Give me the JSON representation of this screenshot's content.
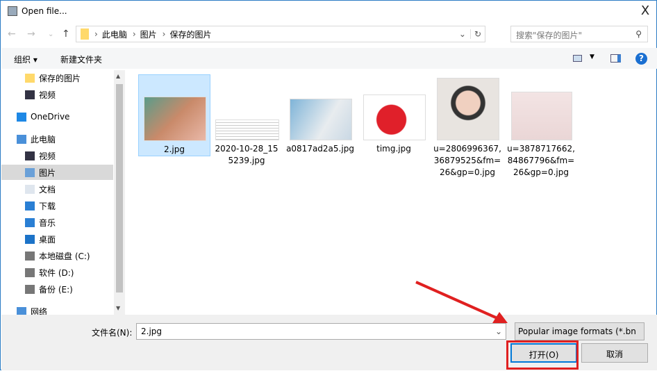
{
  "window": {
    "title": "Open file...",
    "close": "X"
  },
  "nav": {
    "breadcrumb": [
      "此电脑",
      "图片",
      "保存的图片"
    ],
    "search_placeholder": "搜索\"保存的图片\""
  },
  "toolbar": {
    "organize": "组织 ▾",
    "new_folder": "新建文件夹"
  },
  "sidebar": [
    {
      "label": "保存的图片",
      "icon": "folder-icon"
    },
    {
      "label": "视频",
      "icon": "video-icon"
    },
    {
      "label": "OneDrive",
      "icon": "cloud-icon"
    },
    {
      "label": "此电脑",
      "icon": "computer-icon"
    },
    {
      "label": "视频",
      "icon": "video-icon"
    },
    {
      "label": "图片",
      "icon": "pictures-icon",
      "selected": true
    },
    {
      "label": "文档",
      "icon": "document-icon"
    },
    {
      "label": "下载",
      "icon": "download-icon"
    },
    {
      "label": "音乐",
      "icon": "music-icon"
    },
    {
      "label": "桌面",
      "icon": "desktop-icon"
    },
    {
      "label": "本地磁盘 (C:)",
      "icon": "drive-icon"
    },
    {
      "label": "软件 (D:)",
      "icon": "drive-icon"
    },
    {
      "label": "备份 (E:)",
      "icon": "drive-icon"
    },
    {
      "label": "网络",
      "icon": "network-icon"
    }
  ],
  "files": [
    {
      "name": "2.jpg",
      "selected": true
    },
    {
      "name": "2020-10-28_155239.jpg"
    },
    {
      "name": "a0817ad2a5.jpg"
    },
    {
      "name": "timg.jpg"
    },
    {
      "name": "u=2806996367,36879525&fm=26&gp=0.jpg"
    },
    {
      "name": "u=3878717662,84867796&fm=26&gp=0.jpg"
    }
  ],
  "bottom": {
    "filename_label": "文件名(N):",
    "filename_value": "2.jpg",
    "filetype": "Popular image formats (*.bn",
    "open": "打开(O)",
    "cancel": "取消"
  },
  "colors": {
    "accent": "#0078d7",
    "annotation": "#e02020"
  }
}
